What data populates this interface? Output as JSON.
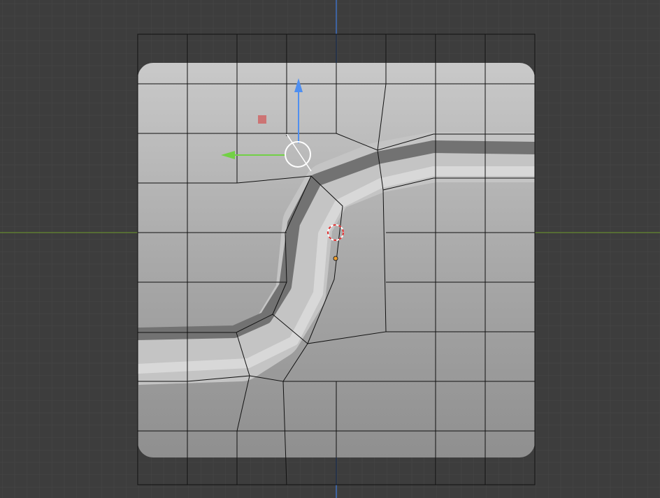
{
  "viewport": {
    "background_color": "#3d3d3d",
    "grid_color": "#474747",
    "x_axis_color": "#7aa32a",
    "z_axis_color": "#3f6fc0",
    "mesh_edge_color": "#111111"
  },
  "gizmo": {
    "z_arrow_color": "#4f8ff0",
    "y_arrow_color": "#72d045",
    "plane_handle_color": "#d06060",
    "pivot_ring_color": "#ffffff"
  },
  "cursor_3d": {
    "ring_colors": [
      "#e03030",
      "#ffffff"
    ]
  },
  "origin_dot_color": "#f0a030"
}
